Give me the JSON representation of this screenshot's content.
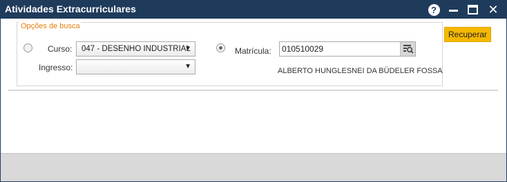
{
  "window": {
    "title": "Atividades Extracurriculares",
    "controls": {
      "help_glyph": "?",
      "close_glyph": "✕"
    }
  },
  "search_options": {
    "legend": "Opções de busca",
    "curso": {
      "label": "Curso:",
      "selected": "047 - DESENHO INDUSTRIAL",
      "radio_checked": false
    },
    "ingresso": {
      "label": "Ingresso:",
      "selected": ""
    },
    "matricula": {
      "label": "Matrícula:",
      "value": "010510029",
      "radio_checked": true
    },
    "student_name": "ALBERTO HUNGLESNEI DA BÜDELER FOSSA"
  },
  "actions": {
    "recuperar_label": "Recuperar"
  },
  "colors": {
    "titlebar": "#1f3b5c",
    "legend": "#e87d0c",
    "button_accent": "#f5b800",
    "footer": "#d9d9d9"
  },
  "icons": {
    "help": "help-icon",
    "minimize": "minimize-icon",
    "maximize": "maximize-icon",
    "close": "close-icon",
    "search": "search-list-icon",
    "dropdown": "dropdown-arrow-icon"
  }
}
